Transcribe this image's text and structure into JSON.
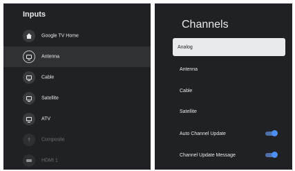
{
  "inputs_panel": {
    "title": "Inputs",
    "items": [
      {
        "label": "Google TV Home",
        "icon": "home-icon"
      },
      {
        "label": "Antenna",
        "icon": "tv-icon",
        "selected": true
      },
      {
        "label": "Cable",
        "icon": "tv-icon"
      },
      {
        "label": "Satellite",
        "icon": "tv-icon"
      },
      {
        "label": "ATV",
        "icon": "tv-icon"
      },
      {
        "label": "Composite",
        "icon": "composite-icon",
        "dimmed": true
      },
      {
        "label": "HDMI 1",
        "icon": "hdmi-icon",
        "dimmed": true
      }
    ]
  },
  "channels_panel": {
    "title": "Channels",
    "items": [
      {
        "label": "Analog",
        "selected": true
      },
      {
        "label": "Antenna"
      },
      {
        "label": "Cable"
      },
      {
        "label": "Satellite"
      },
      {
        "label": "Auto Channel Update",
        "toggle": "on"
      },
      {
        "label": "Channel Update Message",
        "toggle": "on"
      }
    ]
  },
  "colors": {
    "panel_bg": "#202124",
    "selected_row_bg": "#303134",
    "selected_card_bg": "#e8eaed",
    "toggle_on": "#4d8df6"
  }
}
